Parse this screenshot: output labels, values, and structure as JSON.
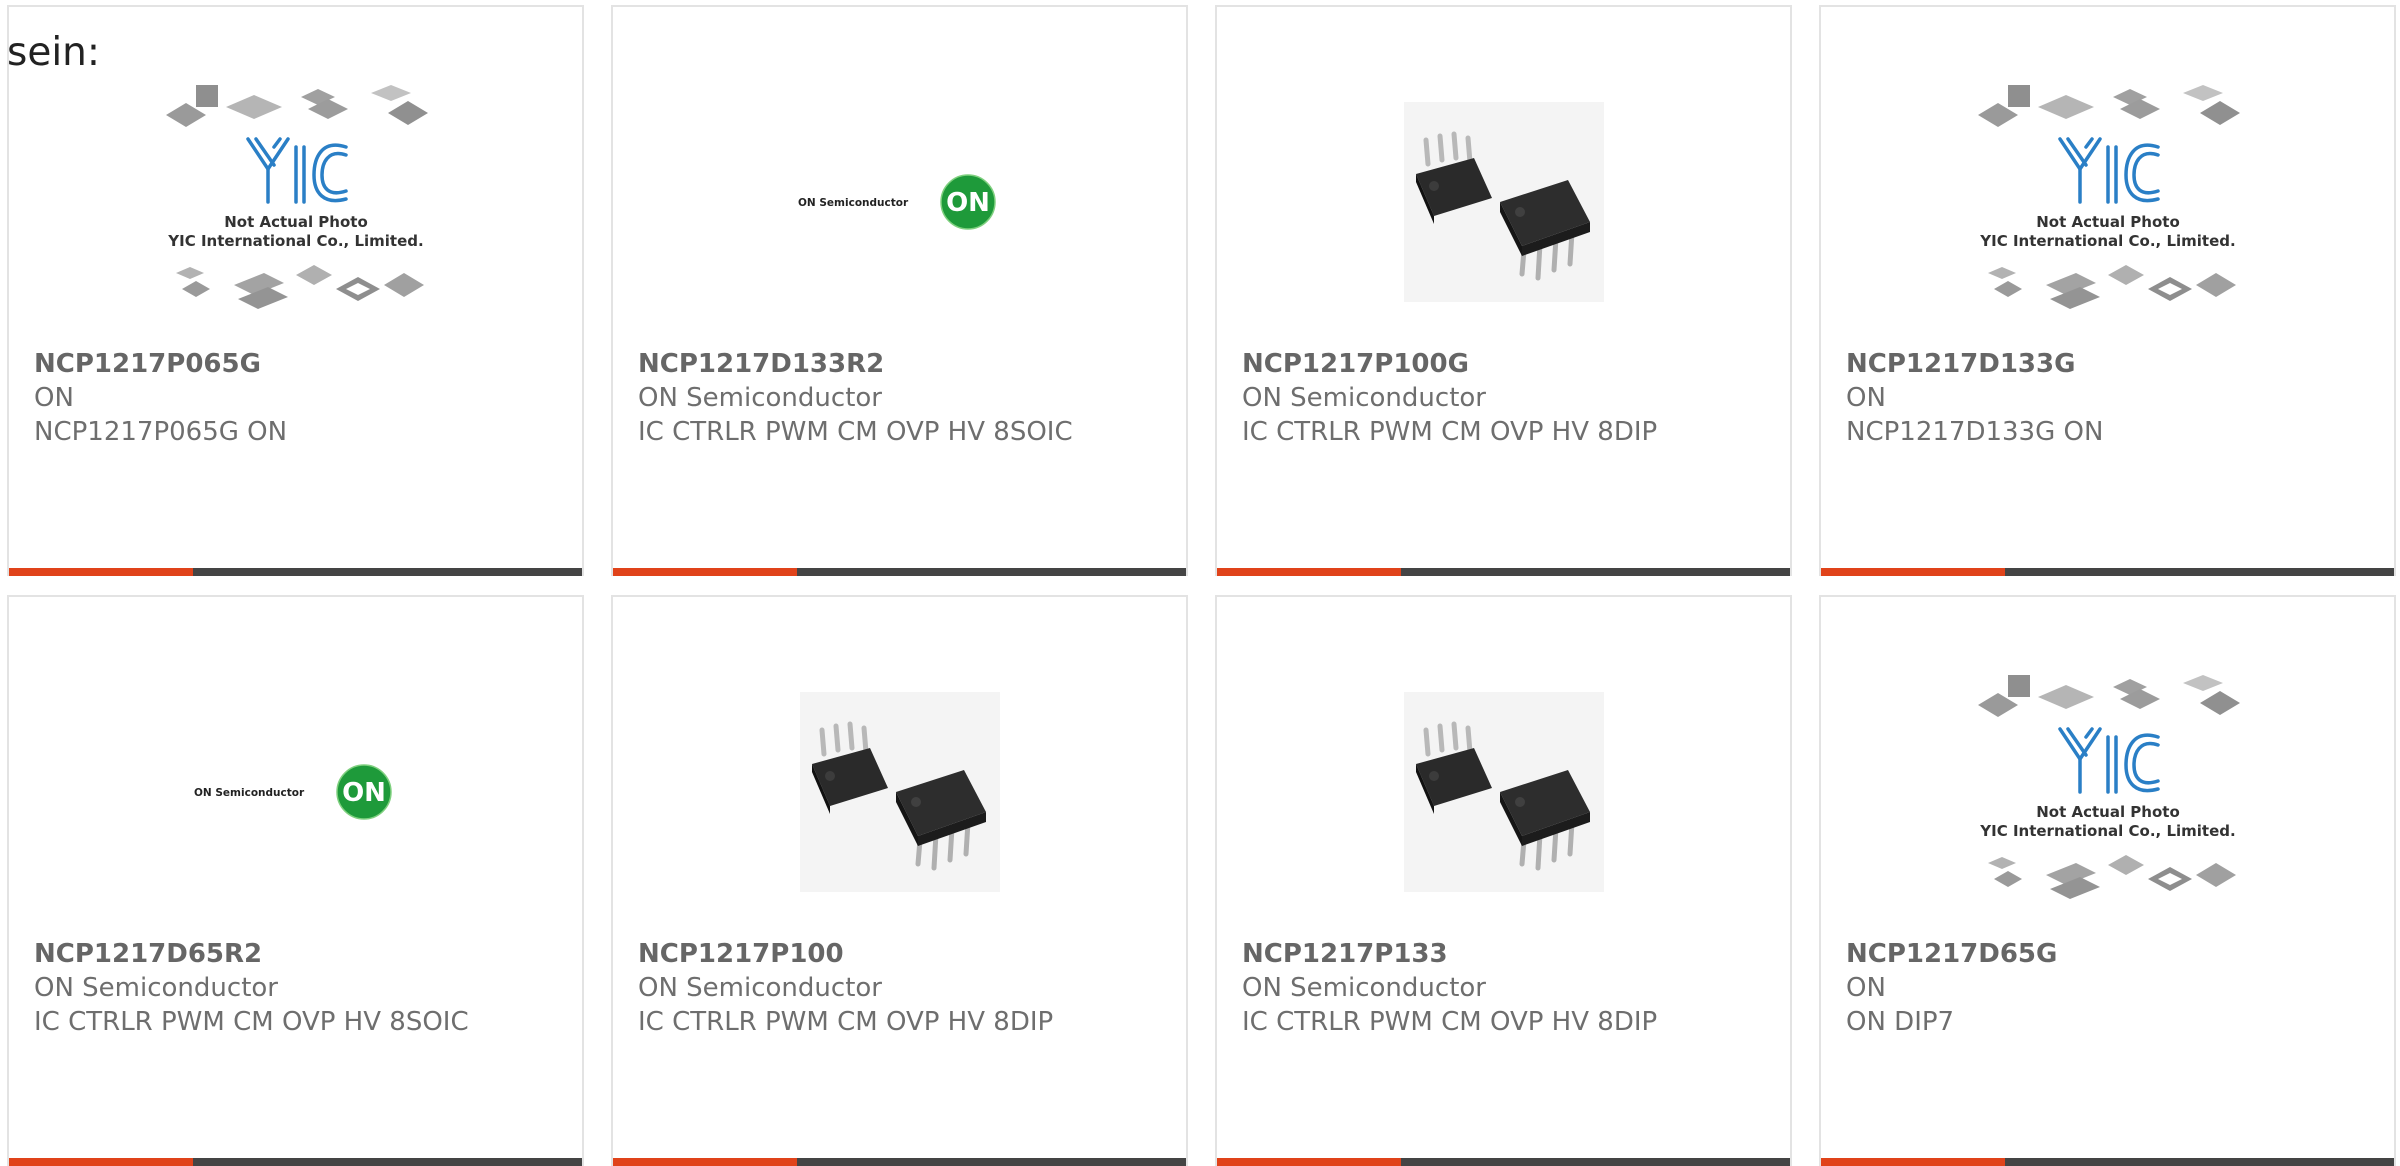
{
  "heading": "sein:",
  "theme": {
    "accent_color": "#e0431a",
    "bar_color": "#444444",
    "border_color": "#e3e3e3",
    "on_logo_green": "#1e9a3a",
    "yic_logo_blue": "#2a7fc6"
  },
  "products": [
    {
      "part_number": "NCP1217P065G",
      "manufacturer": "ON",
      "description": "NCP1217P065G ON",
      "image": "yic-placeholder-image",
      "image_caption_1": "Not Actual Photo",
      "image_caption_2": "YIC International Co., Limited."
    },
    {
      "part_number": "NCP1217D133R2",
      "manufacturer": "ON Semiconductor",
      "description": "IC CTRLR PWM CM OVP HV 8SOIC",
      "image": "on-semiconductor-logo",
      "logo_text": "ON Semiconductor",
      "logo_badge": "ON"
    },
    {
      "part_number": "NCP1217P100G",
      "manufacturer": "ON Semiconductor",
      "description": "IC CTRLR PWM CM OVP HV 8DIP",
      "image": "dip-chip-photo"
    },
    {
      "part_number": "NCP1217D133G",
      "manufacturer": "ON",
      "description": "NCP1217D133G ON",
      "image": "yic-placeholder-image",
      "image_caption_1": "Not Actual Photo",
      "image_caption_2": "YIC International Co., Limited."
    },
    {
      "part_number": "NCP1217D65R2",
      "manufacturer": "ON Semiconductor",
      "description": "IC CTRLR PWM CM OVP HV 8SOIC",
      "image": "on-semiconductor-logo",
      "logo_text": "ON Semiconductor",
      "logo_badge": "ON"
    },
    {
      "part_number": "NCP1217P100",
      "manufacturer": "ON Semiconductor",
      "description": "IC CTRLR PWM CM OVP HV 8DIP",
      "image": "dip-chip-photo"
    },
    {
      "part_number": "NCP1217P133",
      "manufacturer": "ON Semiconductor",
      "description": "IC CTRLR PWM CM OVP HV 8DIP",
      "image": "dip-chip-photo"
    },
    {
      "part_number": "NCP1217D65G",
      "manufacturer": "ON",
      "description": "ON DIP7",
      "image": "yic-placeholder-image",
      "image_caption_1": "Not Actual Photo",
      "image_caption_2": "YIC International Co., Limited."
    }
  ]
}
